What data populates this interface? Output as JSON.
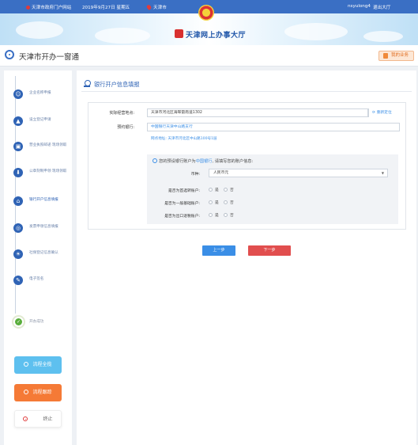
{
  "topbar": {
    "portal": "天津市政府门户网站",
    "date": "2019年9月27日 星期五",
    "city": "天津市",
    "user": "nsyulong4",
    "logout": "退出大厅"
  },
  "banner": {
    "logo_text": "天津网上办事大厅"
  },
  "header": {
    "title": "天津市开办一窗通",
    "my_business": "我的业务"
  },
  "steps": [
    {
      "label": "企业名称申报",
      "icon": "user-icon"
    },
    {
      "label": "设立登记申请",
      "icon": "building-icon"
    },
    {
      "label": "营业执照邮递 现场领取",
      "icon": "id-card-icon"
    },
    {
      "label": "公章刻制申领 现场领取",
      "icon": "stamp-icon"
    },
    {
      "label": "银行开户信息填报",
      "icon": "bank-user-icon"
    },
    {
      "label": "发票申领信息填报",
      "icon": "invoice-icon"
    },
    {
      "label": "社保登记信息确认",
      "icon": "insurance-icon"
    },
    {
      "label": "电子签名",
      "icon": "pen-icon"
    }
  ],
  "success_label": "开办成功",
  "side_buttons": {
    "process_all": "流程全揽",
    "process_track": "流程跟踪",
    "stop": "终止"
  },
  "panel": {
    "title": "银行开户信息填报",
    "address_label": "实际经营地点:",
    "address_value": "天津市河北区海晖雷南道1302",
    "relocate": "重新定位",
    "bank_label": "预约银行:",
    "bank_value": "中国银行天津中山路支行",
    "net_address": "网点地址: 天津市河北区中山路100号1层",
    "tip_prefix": "您的预设银行账户为",
    "tip_bank": "中国银行",
    "tip_suffix": ", 请填写您的账户信息:",
    "currency_label": "币种:",
    "currency_value": "人民币元",
    "q1": "是否为首选转账户:",
    "q2": "是否为一般基础账户:",
    "q3": "是否为出口退税账户:",
    "yes": "是",
    "no": "否",
    "prev": "上一步",
    "next": "下一步"
  }
}
